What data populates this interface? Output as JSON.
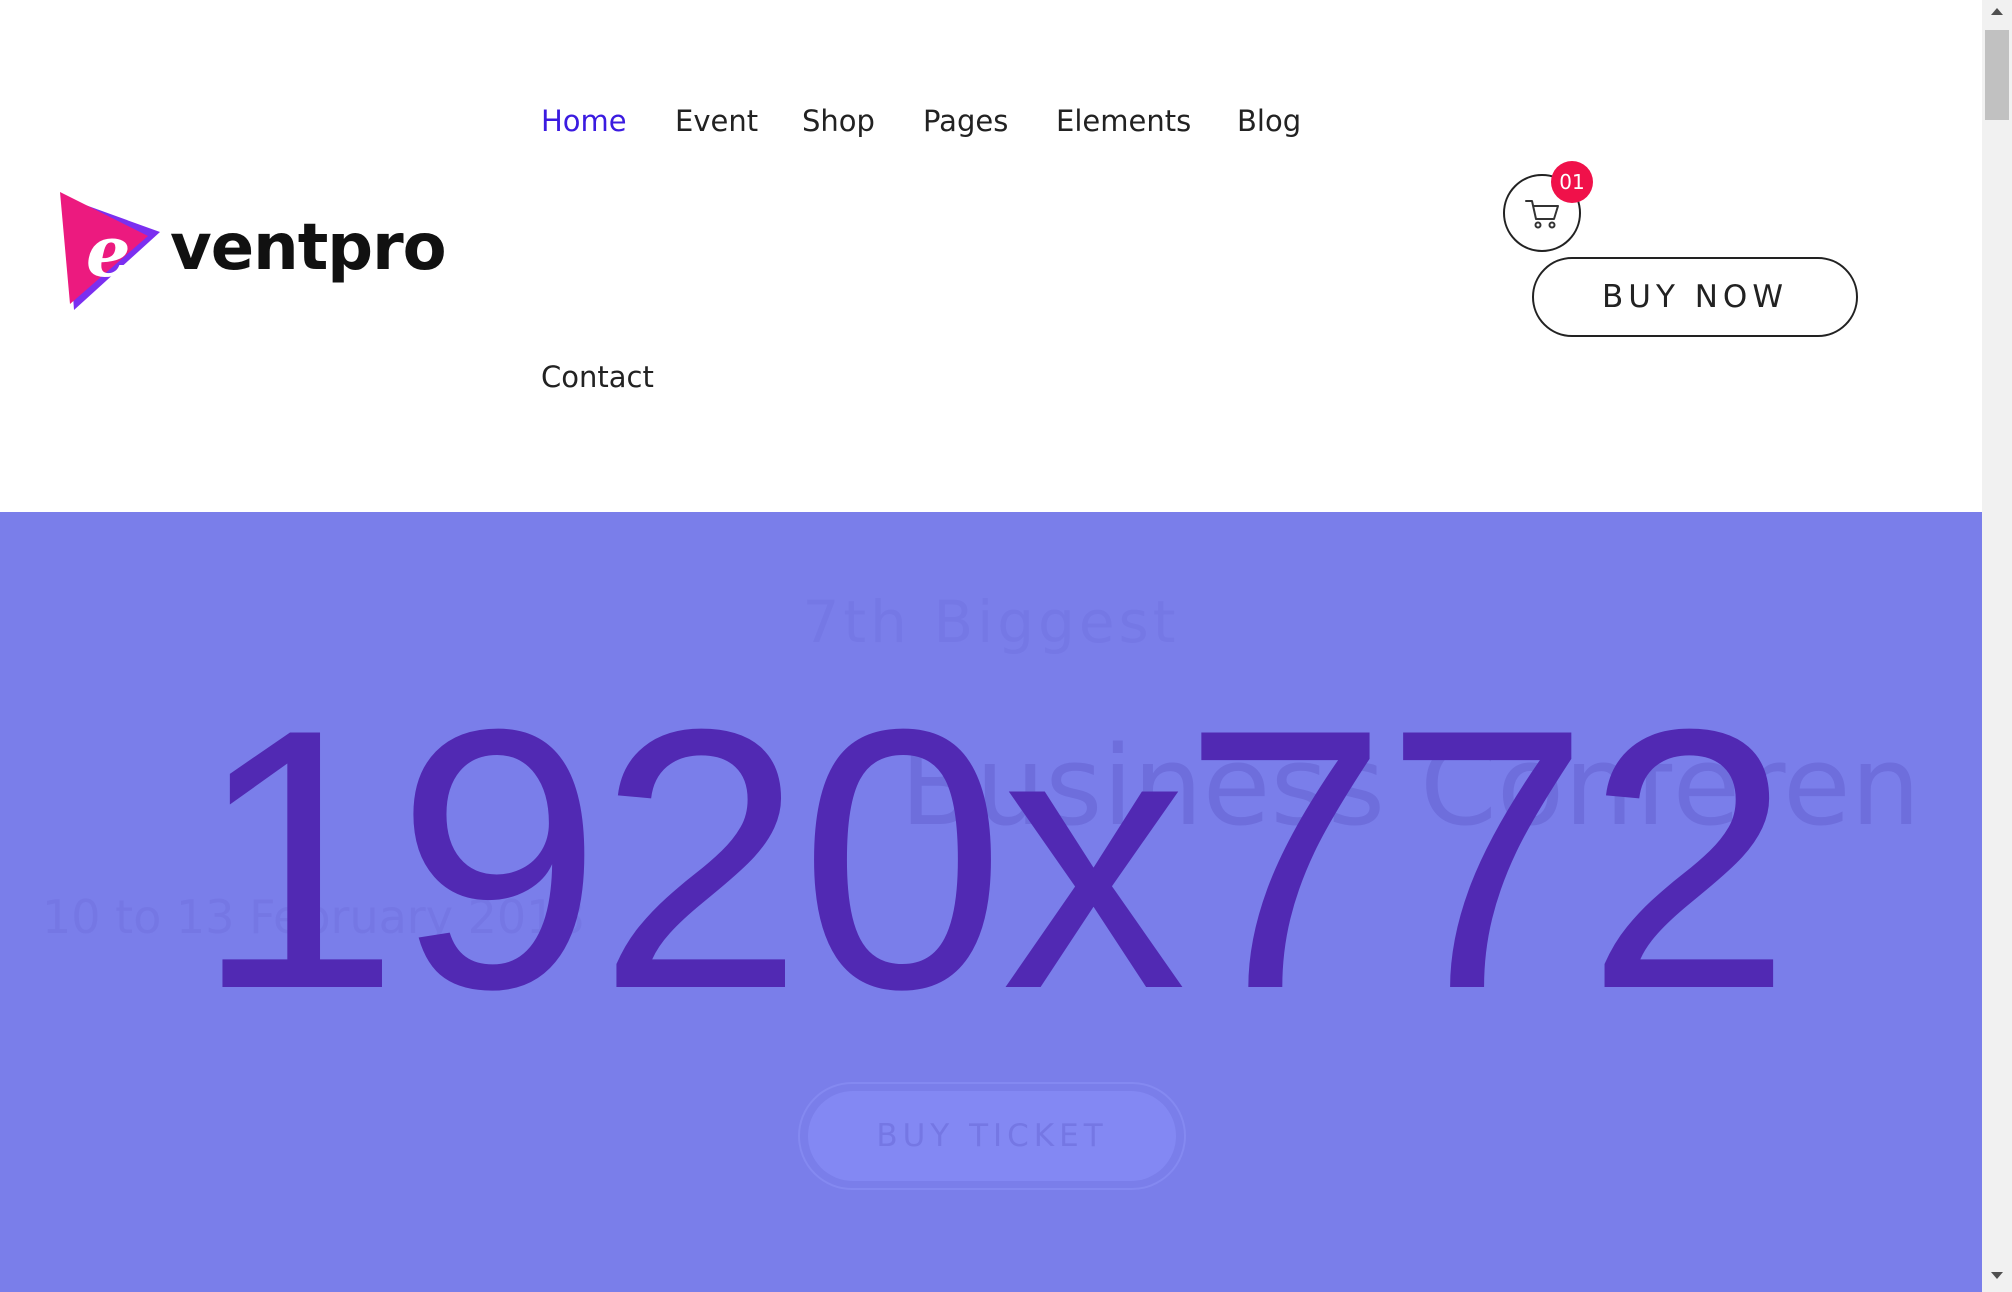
{
  "brand": {
    "wordmark": "ventpro",
    "logo_letter": "e"
  },
  "nav": {
    "items": [
      {
        "label": "Home",
        "active": true
      },
      {
        "label": "Event",
        "active": false
      },
      {
        "label": "Shop",
        "active": false
      },
      {
        "label": "Pages",
        "active": false
      },
      {
        "label": "Elements",
        "active": false
      },
      {
        "label": "Blog",
        "active": false
      },
      {
        "label": "Contact",
        "active": false
      }
    ]
  },
  "cart": {
    "count": "01",
    "icon": "shopping-cart-icon"
  },
  "header_cta": {
    "label": "BUY NOW"
  },
  "hero": {
    "placeholder_text": "1920x772",
    "subtitle": "7th Biggest",
    "title": "Business Conferen",
    "date": "10 to 13 February 2018",
    "cta_label": "BUY TICKET"
  },
  "colors": {
    "accent": "#3b1be0",
    "badge": "#f0114a",
    "hero_bg": "#7a7eea",
    "placeholder_text": "#5129b3",
    "logo_pink": "#ec1a7f",
    "logo_purple": "#7b2ff0"
  }
}
